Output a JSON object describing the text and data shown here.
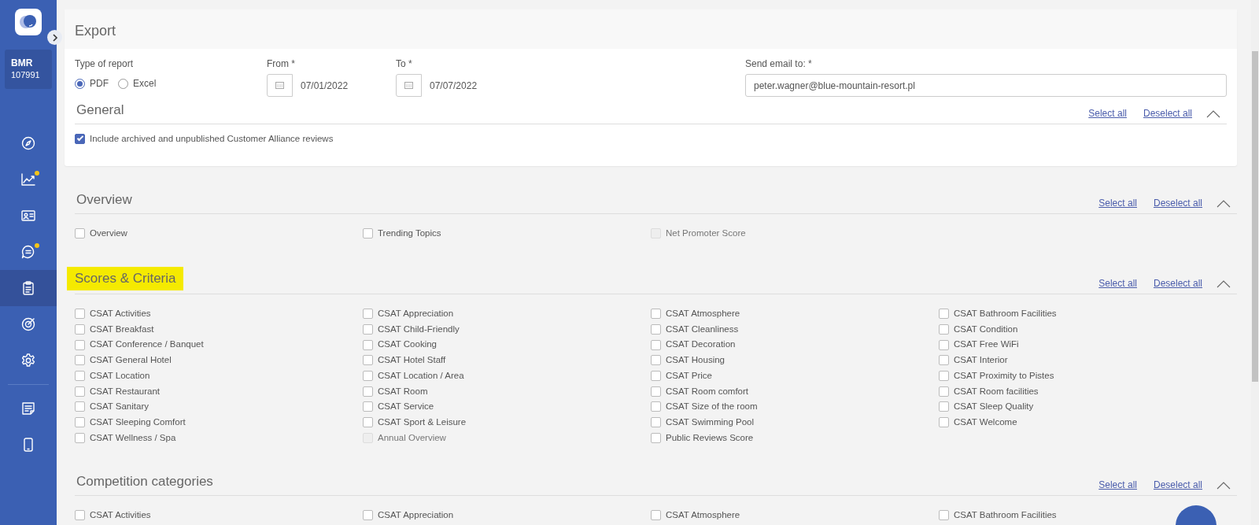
{
  "sidebar": {
    "account": {
      "code": "BMR",
      "number": "107991"
    },
    "items": [
      {
        "kind": "compass",
        "selected": false,
        "notification": false
      },
      {
        "kind": "chart",
        "selected": false,
        "notification": true
      },
      {
        "kind": "contact",
        "selected": false,
        "notification": false
      },
      {
        "kind": "chat",
        "selected": false,
        "notification": true
      },
      {
        "kind": "clipboard",
        "selected": true,
        "notification": false
      },
      {
        "kind": "target",
        "selected": false,
        "notification": false
      },
      {
        "kind": "gear",
        "selected": false,
        "notification": false
      },
      {
        "kind": "divider"
      },
      {
        "kind": "note",
        "selected": false,
        "notification": false
      },
      {
        "kind": "phone",
        "selected": false,
        "notification": false
      }
    ]
  },
  "export": {
    "title": "Export",
    "report_type": {
      "label": "Type of report",
      "options": [
        {
          "label": "PDF",
          "selected": true
        },
        {
          "label": "Excel",
          "selected": false
        }
      ]
    },
    "from": {
      "label": "From *",
      "value": "07/01/2022"
    },
    "to": {
      "label": "To *",
      "value": "07/07/2022"
    },
    "email": {
      "label": "Send email to: *",
      "value": "peter.wagner@blue-mountain-resort.pl"
    }
  },
  "sections": [
    {
      "title": "General",
      "in_card": true,
      "highlighted": false,
      "select_all": "Select all",
      "deselect_all": "Deselect all",
      "items": [
        {
          "label": "Include archived and unpublished Customer Alliance reviews",
          "checked": true,
          "disabled": false
        }
      ]
    },
    {
      "title": "Overview",
      "in_card": false,
      "highlighted": false,
      "select_all": "Select all",
      "deselect_all": "Deselect all",
      "items": [
        {
          "label": "Overview",
          "checked": false,
          "disabled": false
        },
        {
          "label": "Trending Topics",
          "checked": false,
          "disabled": false
        },
        {
          "label": "Net Promoter Score",
          "checked": false,
          "disabled": true
        }
      ]
    },
    {
      "title": "Scores & Criteria",
      "in_card": false,
      "highlighted": true,
      "select_all": "Select all",
      "deselect_all": "Deselect all",
      "items": [
        {
          "label": "CSAT Activities",
          "checked": false,
          "disabled": false
        },
        {
          "label": "CSAT Appreciation",
          "checked": false,
          "disabled": false
        },
        {
          "label": "CSAT Atmosphere",
          "checked": false,
          "disabled": false
        },
        {
          "label": "CSAT Bathroom Facilities",
          "checked": false,
          "disabled": false
        },
        {
          "label": "CSAT Breakfast",
          "checked": false,
          "disabled": false
        },
        {
          "label": "CSAT Child-Friendly",
          "checked": false,
          "disabled": false
        },
        {
          "label": "CSAT Cleanliness",
          "checked": false,
          "disabled": false
        },
        {
          "label": "CSAT Condition",
          "checked": false,
          "disabled": false
        },
        {
          "label": "CSAT Conference / Banquet",
          "checked": false,
          "disabled": false
        },
        {
          "label": "CSAT Cooking",
          "checked": false,
          "disabled": false
        },
        {
          "label": "CSAT Decoration",
          "checked": false,
          "disabled": false
        },
        {
          "label": "CSAT Free WiFi",
          "checked": false,
          "disabled": false
        },
        {
          "label": "CSAT General Hotel",
          "checked": false,
          "disabled": false
        },
        {
          "label": "CSAT Hotel Staff",
          "checked": false,
          "disabled": false
        },
        {
          "label": "CSAT Housing",
          "checked": false,
          "disabled": false
        },
        {
          "label": "CSAT Interior",
          "checked": false,
          "disabled": false
        },
        {
          "label": "CSAT Location",
          "checked": false,
          "disabled": false
        },
        {
          "label": "CSAT Location / Area",
          "checked": false,
          "disabled": false
        },
        {
          "label": "CSAT Price",
          "checked": false,
          "disabled": false
        },
        {
          "label": "CSAT Proximity to Pistes",
          "checked": false,
          "disabled": false
        },
        {
          "label": "CSAT Restaurant",
          "checked": false,
          "disabled": false
        },
        {
          "label": "CSAT Room",
          "checked": false,
          "disabled": false
        },
        {
          "label": "CSAT Room comfort",
          "checked": false,
          "disabled": false
        },
        {
          "label": "CSAT Room facilities",
          "checked": false,
          "disabled": false
        },
        {
          "label": "CSAT Sanitary",
          "checked": false,
          "disabled": false
        },
        {
          "label": "CSAT Service",
          "checked": false,
          "disabled": false
        },
        {
          "label": "CSAT Size of the room",
          "checked": false,
          "disabled": false
        },
        {
          "label": "CSAT Sleep Quality",
          "checked": false,
          "disabled": false
        },
        {
          "label": "CSAT Sleeping Comfort",
          "checked": false,
          "disabled": false
        },
        {
          "label": "CSAT Sport & Leisure",
          "checked": false,
          "disabled": false
        },
        {
          "label": "CSAT Swimming Pool",
          "checked": false,
          "disabled": false
        },
        {
          "label": "CSAT Welcome",
          "checked": false,
          "disabled": false
        },
        {
          "label": "CSAT Wellness / Spa",
          "checked": false,
          "disabled": false
        },
        {
          "label": "Annual Overview",
          "checked": false,
          "disabled": true
        },
        {
          "label": "Public Reviews Score",
          "checked": false,
          "disabled": false
        }
      ]
    },
    {
      "title": "Competition categories",
      "in_card": false,
      "highlighted": false,
      "select_all": "Select all",
      "deselect_all": "Deselect all",
      "items": [
        {
          "label": "CSAT Activities",
          "checked": false,
          "disabled": false
        },
        {
          "label": "CSAT Appreciation",
          "checked": false,
          "disabled": false
        },
        {
          "label": "CSAT Atmosphere",
          "checked": false,
          "disabled": false
        },
        {
          "label": "CSAT Bathroom Facilities",
          "checked": false,
          "disabled": false
        }
      ]
    }
  ]
}
